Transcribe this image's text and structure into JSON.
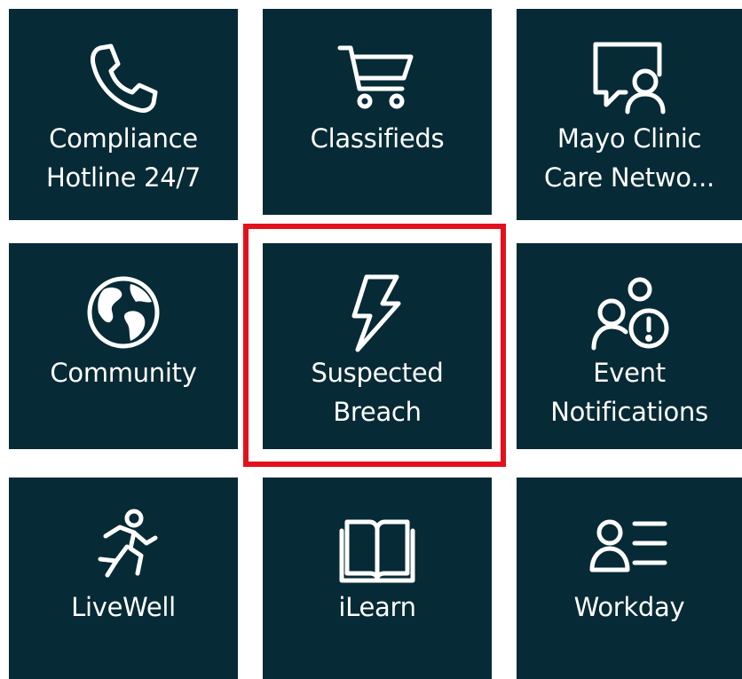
{
  "tiles": [
    {
      "lines": [
        "Compliance",
        "Hotline 24/7"
      ],
      "icon": "phone-icon"
    },
    {
      "lines": [
        "Classifieds"
      ],
      "icon": "cart-icon"
    },
    {
      "lines": [
        "Mayo Clinic",
        "Care Netwo..."
      ],
      "icon": "chat-person-icon"
    },
    {
      "lines": [
        "Community"
      ],
      "icon": "globe-icon"
    },
    {
      "lines": [
        "Suspected",
        "Breach"
      ],
      "icon": "lightning-icon"
    },
    {
      "lines": [
        "Event",
        "Notifications"
      ],
      "icon": "people-alert-icon"
    },
    {
      "lines": [
        "LiveWell"
      ],
      "icon": "running-person-icon"
    },
    {
      "lines": [
        "iLearn"
      ],
      "icon": "book-icon"
    },
    {
      "lines": [
        "Workday"
      ],
      "icon": "person-list-icon"
    }
  ],
  "colors": {
    "tile": "#062a36",
    "text": "#ffffff",
    "highlight": "#e3111c",
    "background": "#ffffff"
  }
}
